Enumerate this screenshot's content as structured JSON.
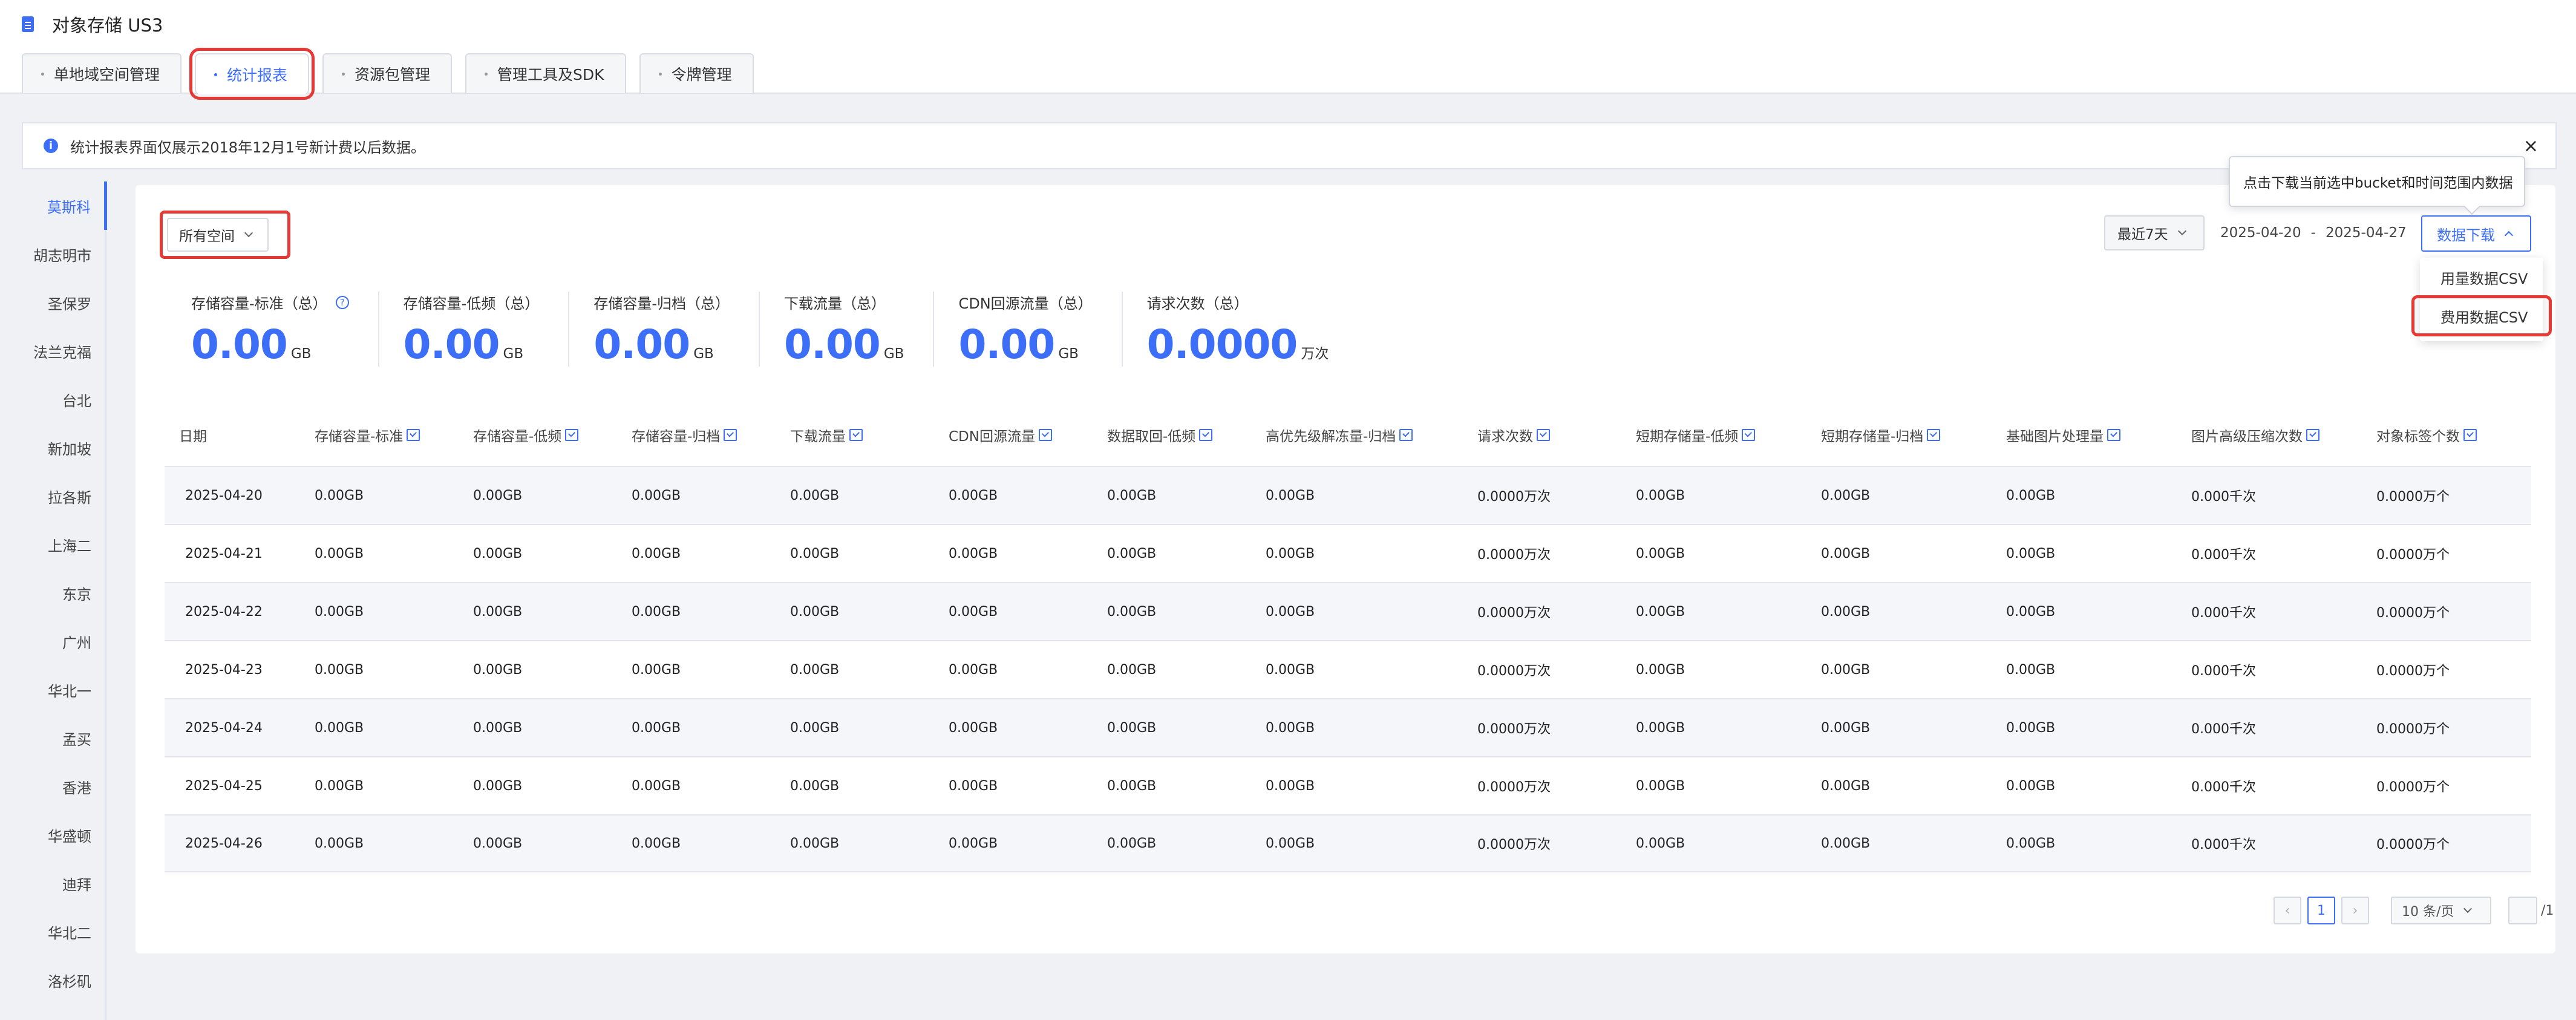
{
  "app": {
    "title": "对象存储 US3"
  },
  "tabs": [
    {
      "label": "单地域空间管理"
    },
    {
      "label": "统计报表"
    },
    {
      "label": "资源包管理"
    },
    {
      "label": "管理工具及SDK"
    },
    {
      "label": "令牌管理"
    }
  ],
  "notice": {
    "text": "统计报表界面仅展示2018年12月1号新计费以后数据。",
    "close": "×",
    "info": "i"
  },
  "regions": [
    "莫斯科",
    "胡志明市",
    "圣保罗",
    "法兰克福",
    "台北",
    "新加坡",
    "拉各斯",
    "上海二",
    "东京",
    "广州",
    "华北一",
    "孟买",
    "香港",
    "华盛顿",
    "迪拜",
    "华北二",
    "洛杉矶"
  ],
  "filters": {
    "bucket": "所有空间",
    "range": "最近7天",
    "start_date": "2025-04-20",
    "separator": "-",
    "end_date": "2025-04-27",
    "download": "数据下载",
    "tooltip": "点击下载当前选中bucket和时间范围内数据",
    "download_options": [
      "用量数据CSV",
      "费用数据CSV"
    ]
  },
  "stats": [
    {
      "label": "存储容量-标准（总）",
      "value": "0.00",
      "unit": "GB"
    },
    {
      "label": "存储容量-低频（总）",
      "value": "0.00",
      "unit": "GB"
    },
    {
      "label": "存储容量-归档（总）",
      "value": "0.00",
      "unit": "GB"
    },
    {
      "label": "下载流量（总）",
      "value": "0.00",
      "unit": "GB"
    },
    {
      "label": "CDN回源流量（总）",
      "value": "0.00",
      "unit": "GB"
    },
    {
      "label": "请求次数（总）",
      "value": "0.0000",
      "unit": "万次"
    }
  ],
  "table": {
    "columns": [
      "日期",
      "存储容量-标准",
      "存储容量-低频",
      "存储容量-归档",
      "下载流量",
      "CDN回源流量",
      "数据取回-低频",
      "高优先级解冻量-归档",
      "请求次数",
      "短期存储量-低频",
      "短期存储量-归档",
      "基础图片处理量",
      "图片高级压缩次数",
      "对象标签个数"
    ],
    "rows": [
      [
        "2025-04-20",
        "0.00GB",
        "0.00GB",
        "0.00GB",
        "0.00GB",
        "0.00GB",
        "0.00GB",
        "0.00GB",
        "0.0000万次",
        "0.00GB",
        "0.00GB",
        "0.00GB",
        "0.000千次",
        "0.0000万个"
      ],
      [
        "2025-04-21",
        "0.00GB",
        "0.00GB",
        "0.00GB",
        "0.00GB",
        "0.00GB",
        "0.00GB",
        "0.00GB",
        "0.0000万次",
        "0.00GB",
        "0.00GB",
        "0.00GB",
        "0.000千次",
        "0.0000万个"
      ],
      [
        "2025-04-22",
        "0.00GB",
        "0.00GB",
        "0.00GB",
        "0.00GB",
        "0.00GB",
        "0.00GB",
        "0.00GB",
        "0.0000万次",
        "0.00GB",
        "0.00GB",
        "0.00GB",
        "0.000千次",
        "0.0000万个"
      ],
      [
        "2025-04-23",
        "0.00GB",
        "0.00GB",
        "0.00GB",
        "0.00GB",
        "0.00GB",
        "0.00GB",
        "0.00GB",
        "0.0000万次",
        "0.00GB",
        "0.00GB",
        "0.00GB",
        "0.000千次",
        "0.0000万个"
      ],
      [
        "2025-04-24",
        "0.00GB",
        "0.00GB",
        "0.00GB",
        "0.00GB",
        "0.00GB",
        "0.00GB",
        "0.00GB",
        "0.0000万次",
        "0.00GB",
        "0.00GB",
        "0.00GB",
        "0.000千次",
        "0.0000万个"
      ],
      [
        "2025-04-25",
        "0.00GB",
        "0.00GB",
        "0.00GB",
        "0.00GB",
        "0.00GB",
        "0.00GB",
        "0.00GB",
        "0.0000万次",
        "0.00GB",
        "0.00GB",
        "0.00GB",
        "0.000千次",
        "0.0000万个"
      ],
      [
        "2025-04-26",
        "0.00GB",
        "0.00GB",
        "0.00GB",
        "0.00GB",
        "0.00GB",
        "0.00GB",
        "0.00GB",
        "0.0000万次",
        "0.00GB",
        "0.00GB",
        "0.00GB",
        "0.000千次",
        "0.0000万个"
      ]
    ]
  },
  "pagination": {
    "prev": "‹",
    "current": "1",
    "next": "›",
    "page_size": "10 条/页",
    "total": "/1"
  },
  "colors": {
    "accent": "#3d6ef7",
    "highlight": "#e53935"
  }
}
